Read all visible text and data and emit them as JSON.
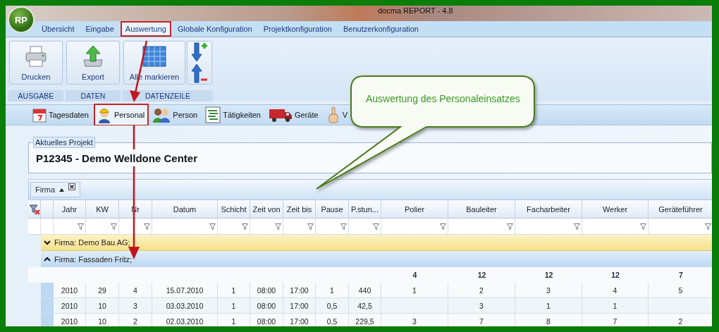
{
  "window": {
    "logo": "RP",
    "title": "docma REPORT - 4.8"
  },
  "menu_tabs": [
    {
      "label": "Übersicht",
      "selected": false
    },
    {
      "label": "Eingabe",
      "selected": false
    },
    {
      "label": "Auswertung",
      "selected": true
    },
    {
      "label": "Globale Konfiguration",
      "selected": false
    },
    {
      "label": "Projektkonfiguration",
      "selected": false
    },
    {
      "label": "Benutzerkonfiguration",
      "selected": false
    }
  ],
  "ribbon_groups": [
    {
      "label": "AUSGABE",
      "buttons": [
        {
          "kind": "large",
          "label": "Drucken"
        }
      ]
    },
    {
      "label": "DATEN",
      "buttons": [
        {
          "kind": "large",
          "label": "Export"
        }
      ]
    },
    {
      "label": "DATENZEILE",
      "buttons": [
        {
          "kind": "large",
          "label": "Alle markieren"
        },
        {
          "kind": "stack"
        }
      ]
    }
  ],
  "view_toolbar": [
    {
      "label": "Tagesdaten",
      "selected": false
    },
    {
      "label": "Personal",
      "selected": true
    },
    {
      "label": "Person",
      "selected": false
    },
    {
      "label": "Tätigkeiten",
      "selected": false
    },
    {
      "label": "Geräte",
      "selected": false
    },
    {
      "label": "V",
      "selected": false
    }
  ],
  "callout": {
    "text": "Auswertung des Personaleinsatzes"
  },
  "project": {
    "legend": "Aktuelles Projekt",
    "title": "P12345 - Demo Welldone Center"
  },
  "grid": {
    "group_chips": [
      {
        "label": "Firma",
        "sort_ascending": true
      }
    ],
    "columns": [
      "Jahr",
      "KW",
      "Nr",
      "Datum",
      "Schicht",
      "Zeit von",
      "Zeit bis",
      "Pause",
      "P.stun...",
      "Polier",
      "Bauleiter",
      "Facharbeiter",
      "Werker",
      "Geräteführer"
    ],
    "groups": [
      {
        "label": "Firma: Demo Bau AG;",
        "expanded": false
      },
      {
        "label": "Firma: Fassaden Fritz;",
        "expanded": true,
        "totals": [
          "4",
          "12",
          "12",
          "12",
          "7"
        ],
        "rows": [
          [
            "2010",
            "29",
            "4",
            "15.07.2010",
            "1",
            "08:00",
            "17:00",
            "1",
            "440",
            "1",
            "2",
            "3",
            "4",
            "5"
          ],
          [
            "2010",
            "10",
            "3",
            "03.03.2010",
            "1",
            "08:00",
            "17:00",
            "0,5",
            "42,5",
            null,
            "3",
            "1",
            "1",
            null
          ],
          [
            "2010",
            "10",
            "2",
            "02.03.2010",
            "1",
            "08:00",
            "17:00",
            "0,5",
            "229,5",
            "3",
            "7",
            "8",
            "7",
            "2"
          ]
        ]
      }
    ]
  }
}
